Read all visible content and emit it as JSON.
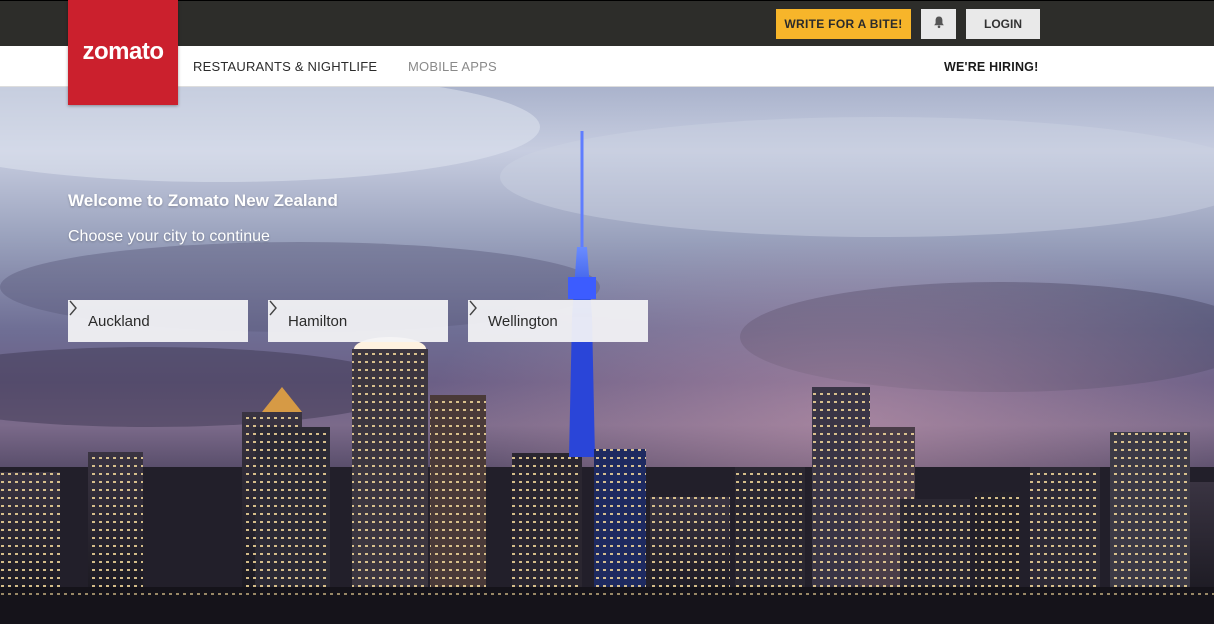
{
  "brand": {
    "logo_text": "zomato",
    "color": "#cb202d"
  },
  "topbar": {
    "write_label": "WRITE FOR A BITE!",
    "write_color": "#f7b52a",
    "bell_icon": "bell-icon",
    "login_label": "LOGIN"
  },
  "nav": {
    "restaurants": "RESTAURANTS & NIGHTLIFE",
    "mobile_apps": "MOBILE APPS",
    "hiring": "WE'RE HIRING!"
  },
  "hero": {
    "title": "Welcome to Zomato New Zealand",
    "subtitle": "Choose your city to continue",
    "cities": [
      {
        "label": "Auckland",
        "icon": "chevron-right-icon"
      },
      {
        "label": "Hamilton",
        "icon": "chevron-right-icon"
      },
      {
        "label": "Wellington",
        "icon": "chevron-right-icon"
      }
    ]
  }
}
